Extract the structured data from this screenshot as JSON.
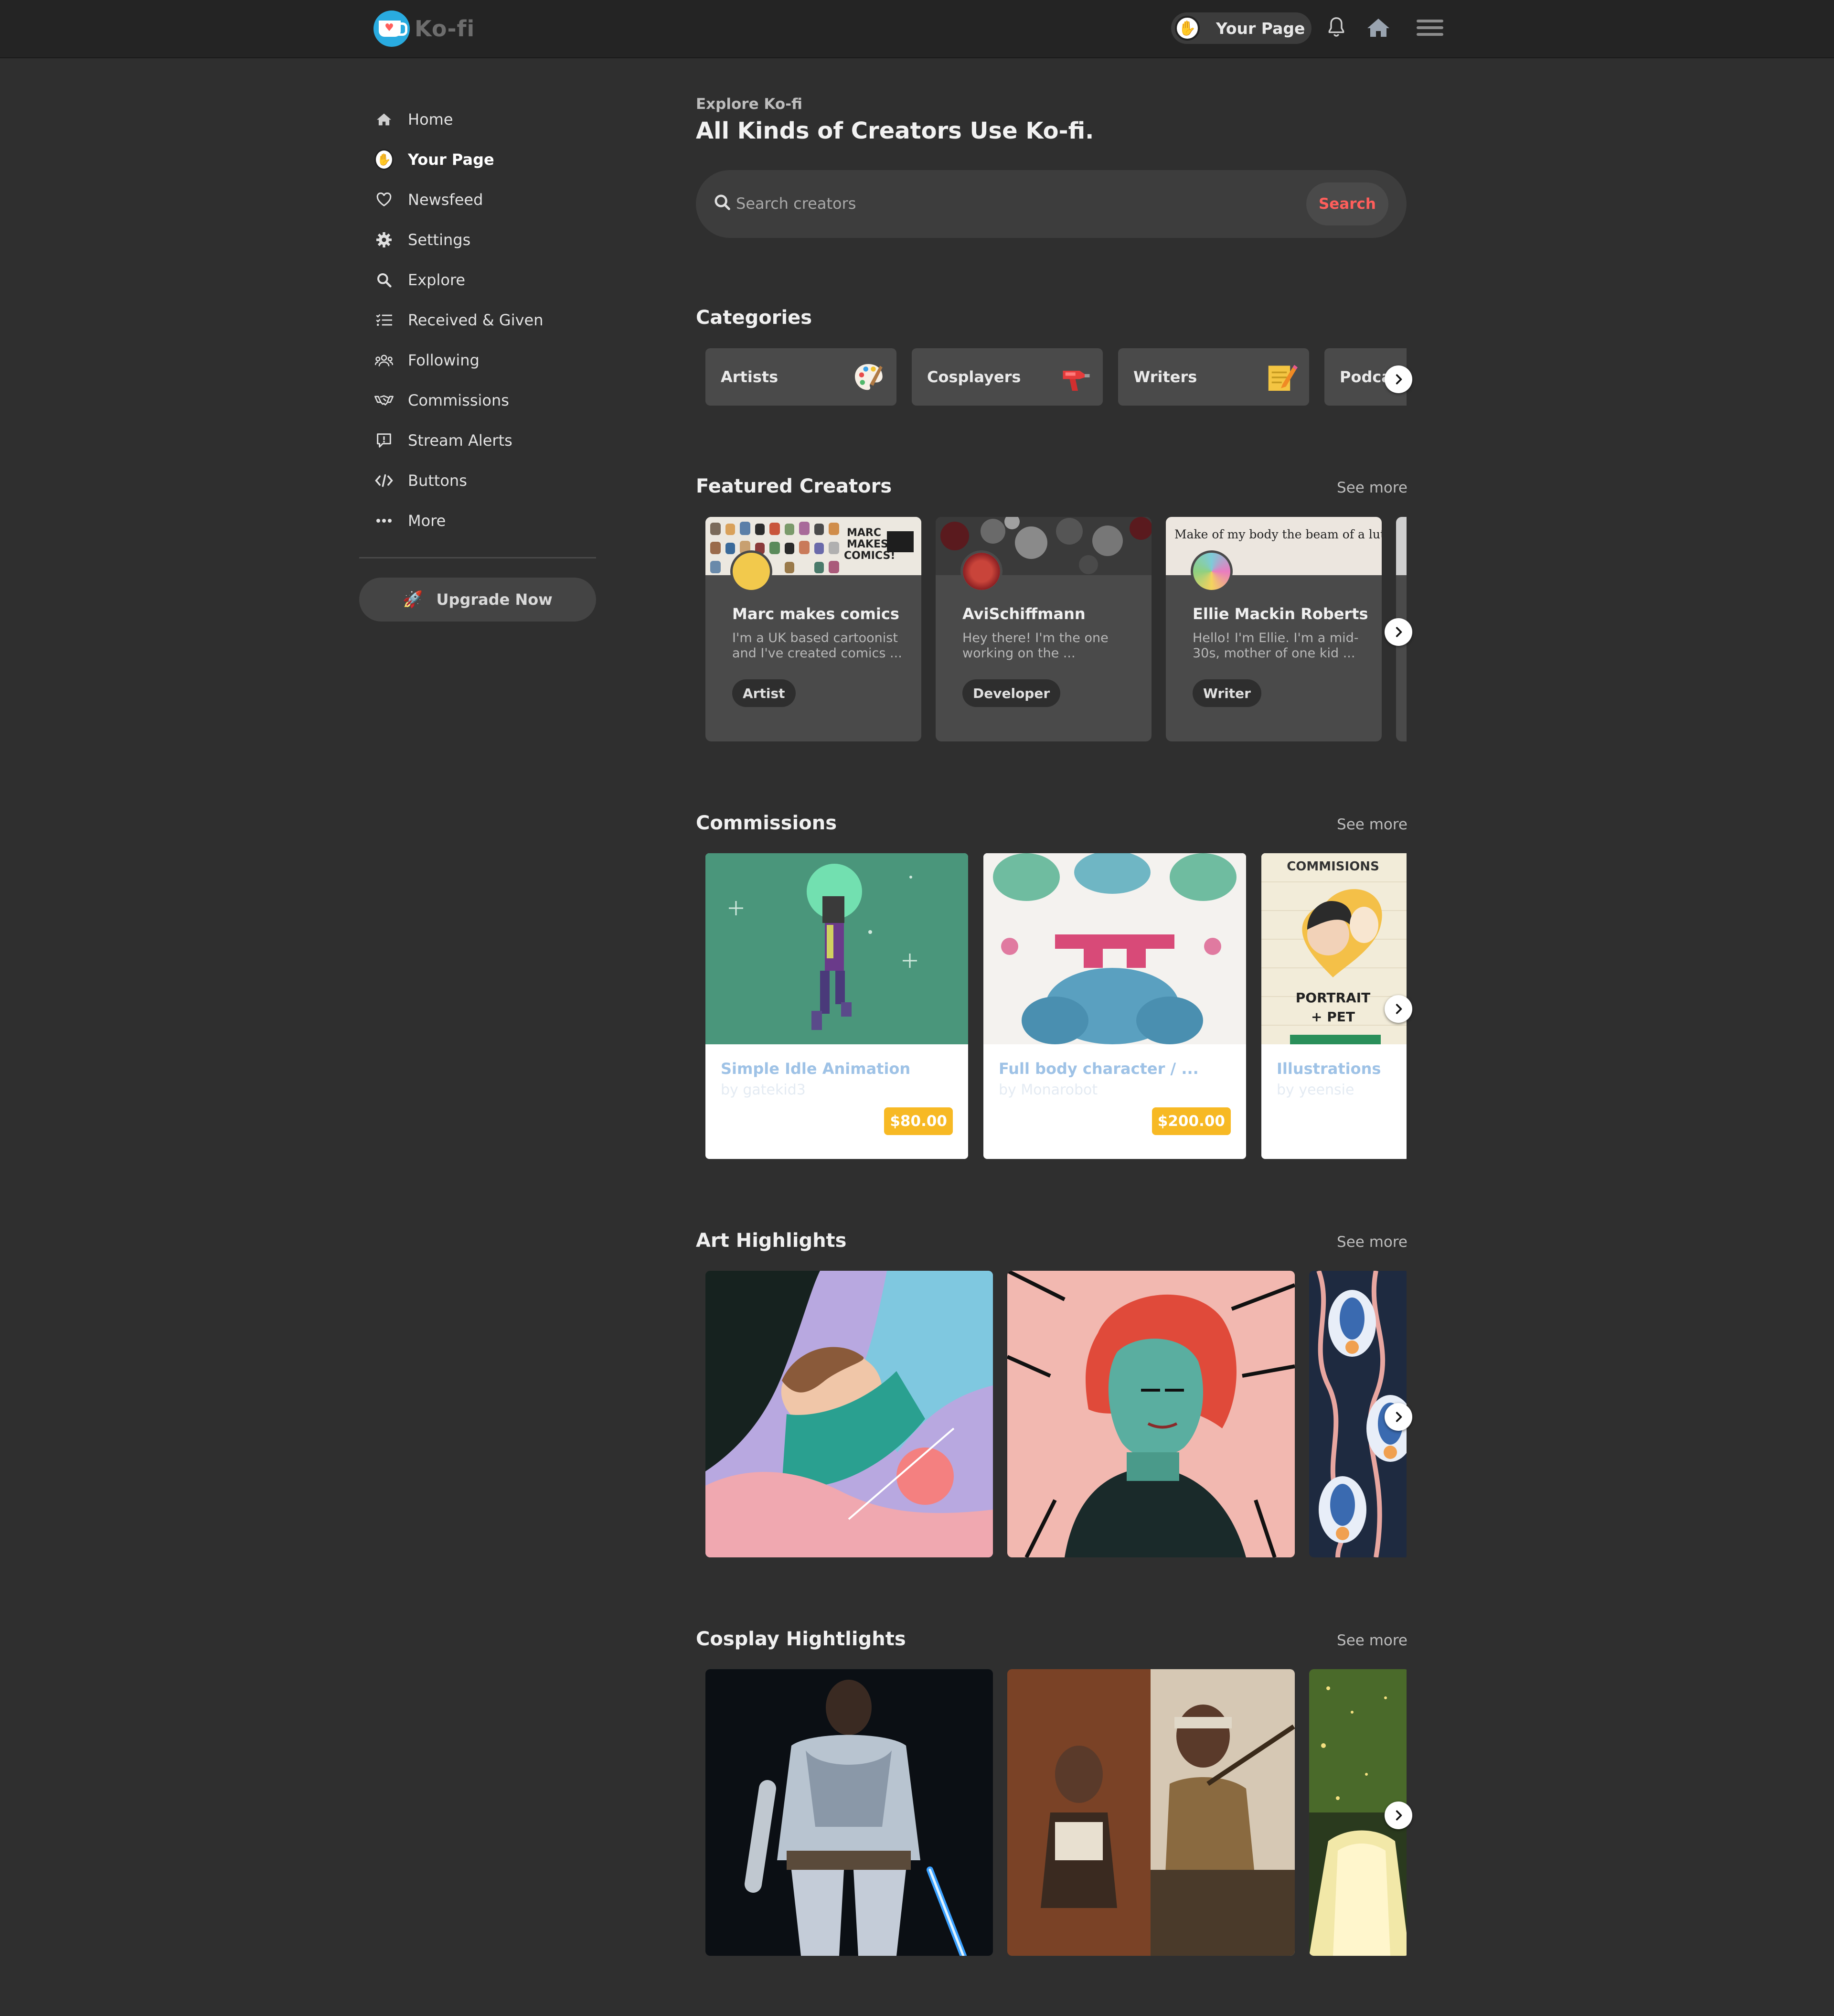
{
  "topbar": {
    "brand": "Ko-fi",
    "your_page_label": "Your Page",
    "icons": [
      "bell-icon",
      "home-icon",
      "menu-icon"
    ]
  },
  "sidebar": {
    "items": [
      {
        "label": "Home",
        "icon": "home-icon",
        "active": false
      },
      {
        "label": "Your Page",
        "icon": "avatar-icon",
        "active": true
      },
      {
        "label": "Newsfeed",
        "icon": "heart-icon",
        "active": false
      },
      {
        "label": "Settings",
        "icon": "gear-icon",
        "active": false
      },
      {
        "label": "Explore",
        "icon": "search-icon",
        "active": false
      },
      {
        "label": "Received & Given",
        "icon": "list-icon",
        "active": false
      },
      {
        "label": "Following",
        "icon": "people-icon",
        "active": false
      },
      {
        "label": "Commissions",
        "icon": "handshake-icon",
        "active": false
      },
      {
        "label": "Stream Alerts",
        "icon": "alert-icon",
        "active": false
      },
      {
        "label": "Buttons",
        "icon": "code-icon",
        "active": false
      },
      {
        "label": "More",
        "icon": "dots-icon",
        "active": false
      }
    ],
    "upgrade_label": "Upgrade Now"
  },
  "main": {
    "kicker": "Explore Ko-fi",
    "title": "All Kinds of Creators Use Ko-fi.",
    "search": {
      "placeholder": "Search creators",
      "button": "Search"
    },
    "categories": {
      "title": "Categories",
      "items": [
        "Artists",
        "Cosplayers",
        "Writers",
        "Podca"
      ]
    },
    "featured": {
      "title": "Featured Creators",
      "see_more": "See more",
      "creators": [
        {
          "name": "Marc makes comics",
          "desc": "I'm a UK based cartoonist and I've created comics ...",
          "tag": "Artist"
        },
        {
          "name": "AviSchiffmann",
          "desc": "Hey there! I'm the one working on the ...",
          "tag": "Developer"
        },
        {
          "name": "Ellie Mackin Roberts",
          "desc": "Hello! I'm Ellie. I'm a mid-30s, mother of one kid ...",
          "tag": "Writer",
          "banner_text": "Make of my body the beam of a lute"
        }
      ]
    },
    "commissions": {
      "title": "Commissions",
      "see_more": "See more",
      "items": [
        {
          "title": "Simple Idle Animation",
          "by": "by gatekid3",
          "price": "$80.00"
        },
        {
          "title": "Full body character / ...",
          "by": "by Monarobot",
          "price": "$200.00"
        },
        {
          "title": "Illustrations",
          "by": "by yeensie",
          "price": ""
        }
      ]
    },
    "art": {
      "title": "Art Highlights",
      "see_more": "See more"
    },
    "cosplay": {
      "title": "Cosplay Hightlights",
      "see_more": "See more"
    }
  },
  "colors": {
    "accent": "#ff5e5b",
    "brand_blue": "#29abe0",
    "price_badge": "#f7b924",
    "background": "#2f2f2f",
    "topbar": "#242424",
    "card": "#4a4a4a"
  }
}
